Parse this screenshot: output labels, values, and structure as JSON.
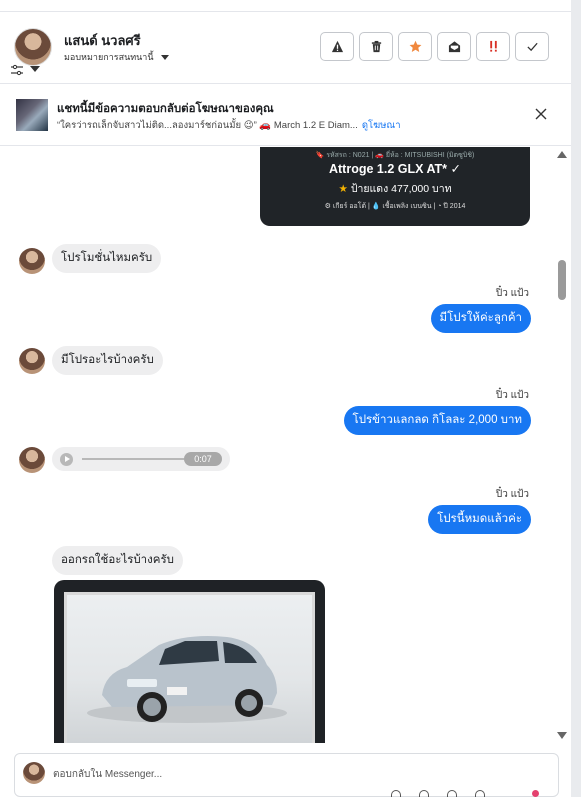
{
  "header": {
    "contact_name": "แสนด์ นวลศรี",
    "assign_label": "มอบหมายการสนทนานี้",
    "actions": [
      {
        "name": "report-button",
        "icon": "warning-icon"
      },
      {
        "name": "delete-button",
        "icon": "trash-icon"
      },
      {
        "name": "star-button",
        "icon": "star-icon"
      },
      {
        "name": "mark-unread-button",
        "icon": "envelope-open-icon"
      },
      {
        "name": "spam-button",
        "icon": "spam-icon"
      },
      {
        "name": "done-button",
        "icon": "check-icon"
      }
    ],
    "colors": {
      "star": "#f0883e",
      "spam": "#d93025"
    }
  },
  "banner": {
    "title": "แชทนี้มีข้อความตอบกลับต่อโฆษณาของคุณ",
    "subtitle": "“ใครว่ารถเล็กจับสาวไม่ติด...ลองมาร์ชก่อนมั้ย 😉” 🚗 March 1.2 E Diam...",
    "link": "ดูโฆษณา"
  },
  "car_card": {
    "meta": "🔖 รหัสรถ : N021 | 🚗 ยี่ห้อ : MITSUBISHI (มิตซูบิชิ)",
    "model": "Attroge 1.2 GLX AT* ✓",
    "price_star": "★",
    "price": "ป้ายแดง 477,000 บาท",
    "specs": "⚙ เกียร์ ออโต้   |   💧 เชื้อเพลิง เบนซิน   |   ◔ ปี 2014"
  },
  "messages": {
    "m1": "โปรโมชั่นไหมครับ",
    "sender1": "ปิ๋ว แป้ว",
    "m2": "มีโปรให้ค่ะลูกค้า",
    "m3": "มีโปรอะไรบ้างครับ",
    "sender2": "ปิ๋ว แป้ว",
    "m4": "โปรข้าวแลกลด กิโลละ 2,000 บาท",
    "audio_time": "0:07",
    "sender3": "ปิ๋ว แป้ว",
    "m5": "โปรนี้หมดแล้วค่ะ",
    "m6": "ออกรถใช้อะไรบ้างครับ"
  },
  "composer": {
    "placeholder": "ตอบกลับใน Messenger..."
  },
  "colors": {
    "outgoing_bubble": "#1877f2",
    "incoming_bubble": "#eeeeef",
    "link": "#1877f2"
  }
}
